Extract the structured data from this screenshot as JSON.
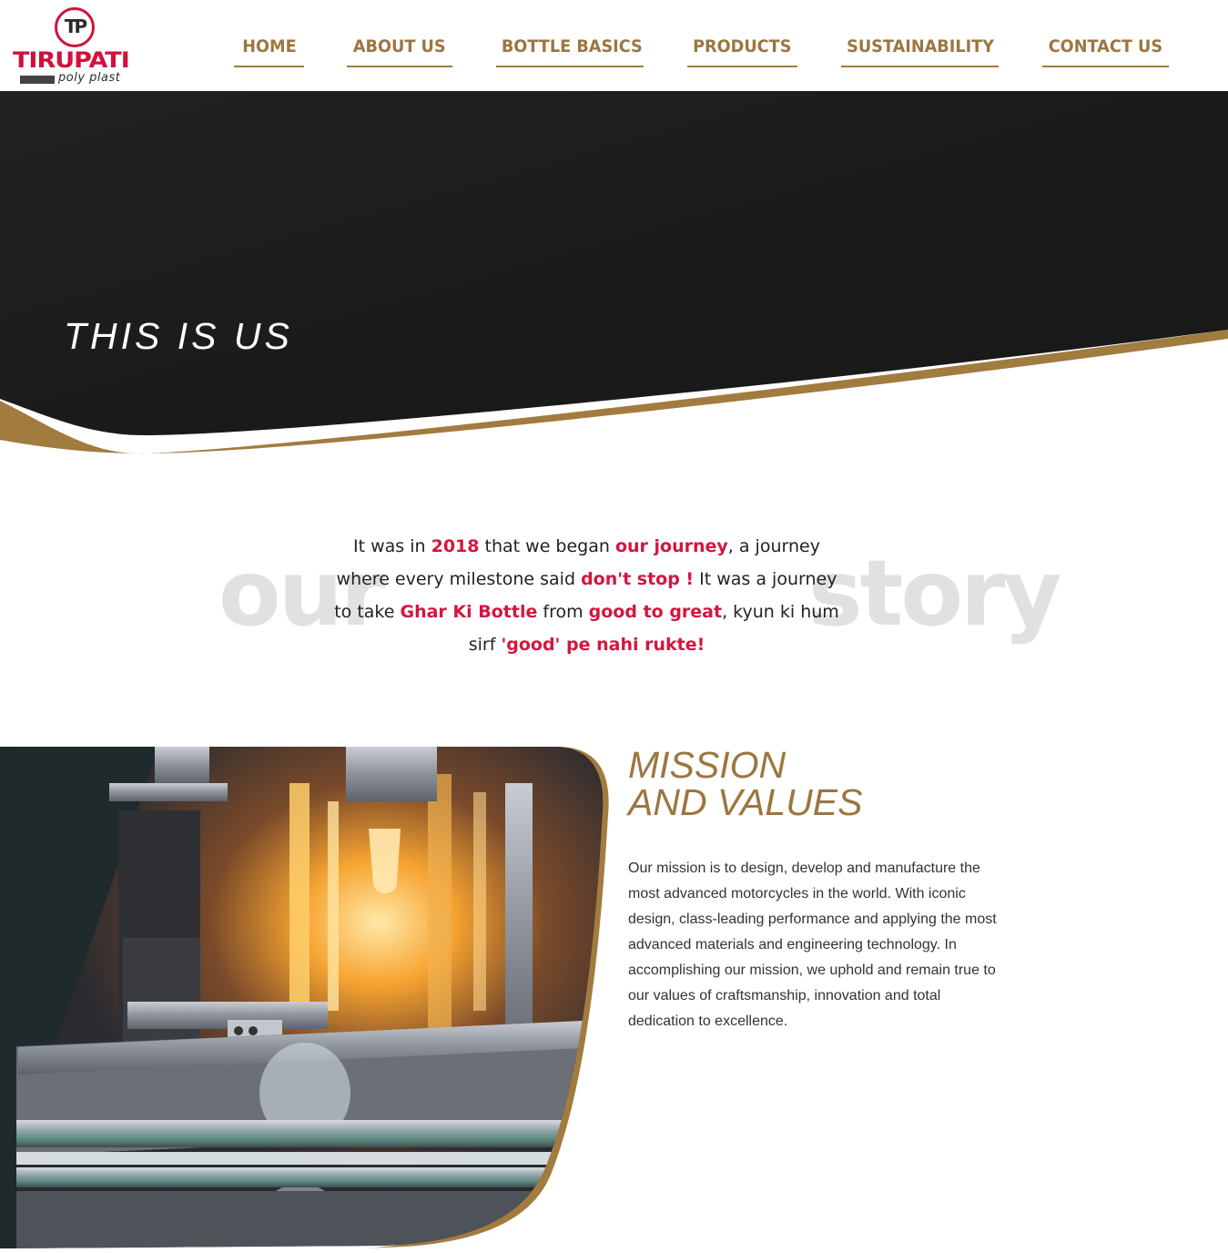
{
  "brand": {
    "mark": "TP",
    "name": "TIRUPATI",
    "tagline": "poly plast"
  },
  "nav": {
    "items": [
      {
        "label": "HOME"
      },
      {
        "label": "ABOUT US"
      },
      {
        "label": "BOTTLE BASICS"
      },
      {
        "label": "PRODUCTS"
      },
      {
        "label": "SUSTAINABILITY"
      },
      {
        "label": "CONTACT US"
      }
    ]
  },
  "hero": {
    "title": "THIS IS US"
  },
  "story": {
    "ghost_left": "our",
    "ghost_right": "story",
    "segments": [
      {
        "text": "It was in ",
        "highlight": false
      },
      {
        "text": "2018",
        "highlight": true
      },
      {
        "text": " that we began ",
        "highlight": false
      },
      {
        "text": "our journey",
        "highlight": true
      },
      {
        "text": ", a journey where every milestone said ",
        "highlight": false
      },
      {
        "text": "don't stop !",
        "highlight": true
      },
      {
        "text": " It was a journey to take ",
        "highlight": false
      },
      {
        "text": "Ghar Ki Bottle",
        "highlight": true
      },
      {
        "text": " from ",
        "highlight": false
      },
      {
        "text": "good to great",
        "highlight": true
      },
      {
        "text": ", kyun ki hum sirf ",
        "highlight": false
      },
      {
        "text": "'good' pe nahi rukte!",
        "highlight": true
      }
    ]
  },
  "mission": {
    "title_line1": "MISSION",
    "title_line2": "AND VALUES",
    "body": "Our mission is to design, develop and manufacture the most advanced motorcycles in the world. With iconic design, class-leading performance and applying the most advanced materials and engineering technology. In accomplishing our mission, we uphold and remain true to our values of craftsmanship, innovation and total dedication to excellence."
  },
  "colors": {
    "gold": "#9c7640",
    "accent_red": "#d4163f",
    "hero_dark": "#1c1c1c"
  }
}
